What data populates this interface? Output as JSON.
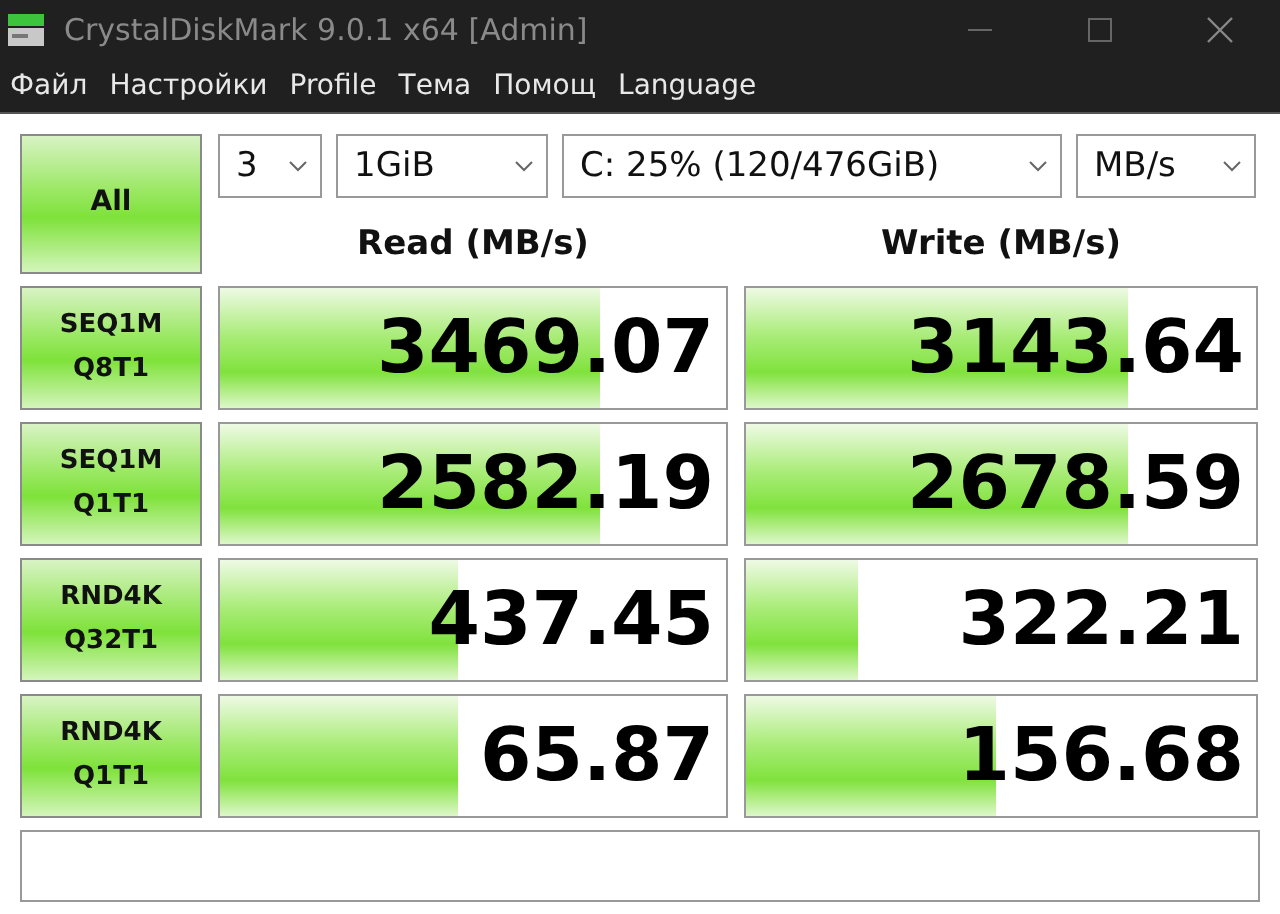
{
  "window": {
    "title": "CrystalDiskMark 9.0.1 x64 [Admin]"
  },
  "menu": [
    "Файл",
    "Настройки",
    "Profile",
    "Тема",
    "Помощ",
    "Language"
  ],
  "all_button": "All",
  "selectors": [
    {
      "value": "3"
    },
    {
      "value": "1GiB"
    },
    {
      "value": "C: 25% (120/476GiB)"
    },
    {
      "value": "MB/s"
    }
  ],
  "columns": [
    "Read (MB/s)",
    "Write (MB/s)"
  ],
  "tests": [
    {
      "name": "SEQ1M",
      "params": "Q8T1",
      "read": {
        "value": "3469.07",
        "level": 0.75
      },
      "write": {
        "value": "3143.64",
        "level": 0.75
      }
    },
    {
      "name": "SEQ1M",
      "params": "Q1T1",
      "read": {
        "value": "2582.19",
        "level": 0.75
      },
      "write": {
        "value": "2678.59",
        "level": 0.75
      }
    },
    {
      "name": "RND4K",
      "params": "Q32T1",
      "read": {
        "value": "437.45",
        "level": 0.47
      },
      "write": {
        "value": "322.21",
        "level": 0.22
      }
    },
    {
      "name": "RND4K",
      "params": "Q1T1",
      "read": {
        "value": "65.87",
        "level": 0.47
      },
      "write": {
        "value": "156.68",
        "level": 0.49
      }
    }
  ]
}
